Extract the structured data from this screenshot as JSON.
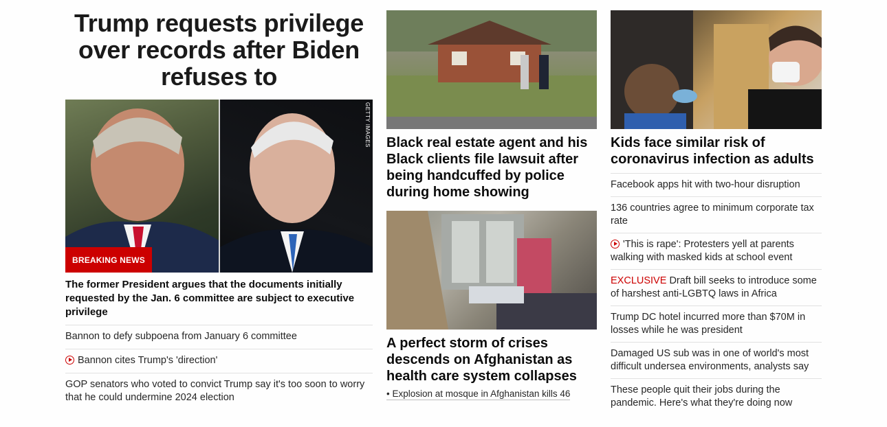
{
  "main": {
    "headline": "Trump requests privilege over records after Biden refuses to",
    "hero_credit": "GETTY IMAGES",
    "hero_badge": "BREAKING NEWS",
    "hero_caption": "The former President argues that the documents initially requested by the Jan. 6 committee are subject to executive privilege",
    "items": [
      {
        "text": "Bannon to defy subpoena from January 6 committee",
        "video": false
      },
      {
        "text": "Bannon cites Trump's 'direction'",
        "video": true
      },
      {
        "text": "GOP senators who voted to convict Trump say it's too soon to worry that he could undermine 2024 election",
        "video": false
      }
    ]
  },
  "middle": {
    "story1": {
      "image_icon": "house-photo",
      "headline": "Black real estate agent and his Black clients file lawsuit after being handcuffed by police during home showing"
    },
    "story2": {
      "image_icon": "hospital-photo",
      "headline": "A perfect storm of crises descends on Afghanistan as health care system collapses",
      "sub": "• Explosion at mosque in Afghanistan kills 46"
    }
  },
  "right": {
    "image_icon": "kids-photo",
    "headline": "Kids face similar risk of coronavirus infection as adults",
    "items": [
      {
        "text": "Facebook apps hit with two-hour disruption"
      },
      {
        "text": "136 countries agree to minimum corporate tax rate"
      },
      {
        "text": "'This is rape': Protesters yell at parents walking with masked kids at school event",
        "video": true
      },
      {
        "prefix": "EXCLUSIVE",
        "text": "Draft bill seeks to introduce some of harshest anti-LGBTQ laws in Africa"
      },
      {
        "text": "Trump DC hotel incurred more than $70M in losses while he was president"
      },
      {
        "text": "Damaged US sub was in one of world's most difficult undersea environments, analysts say"
      },
      {
        "text": "These people quit their jobs during the pandemic. Here's what they're doing now"
      }
    ]
  },
  "colors": {
    "accent": "#cc0000",
    "rule": "#e1e1e1"
  }
}
